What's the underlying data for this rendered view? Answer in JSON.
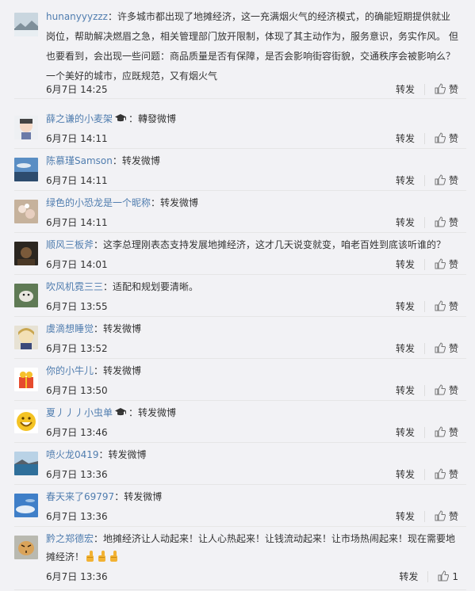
{
  "actions": {
    "repost_label": "转发",
    "like_label": "赞"
  },
  "comments": [
    {
      "user": "hunanyyyzzz",
      "text": "：许多城市都出现了地摊经济，这一充满烟火气的经济模式，的确能短期提供就业岗位，帮助解决燃眉之急，相关管理部门放开限制，体现了其主动作为，服务意识，务实作风。 但也要看到，会出现一些问题：商品质量是否有保障，是否会影响街容街貌，交通秩序会被影响么？ 一个美好的城市，应既规范，又有烟火气",
      "time": "6月7日 14:25",
      "avatar": "mountain"
    },
    {
      "user": "薛之谦的小麦架",
      "badge": true,
      "text": "：轉發微博",
      "time": "6月7日 14:11",
      "avatar": "cartoon"
    },
    {
      "user": "陈慕瑾Samson",
      "text": "：转发微博",
      "time": "6月7日 14:11",
      "avatar": "sky"
    },
    {
      "user": "绿色的小恐龙是一个昵称",
      "text": "：转发微博",
      "time": "6月7日 14:11",
      "avatar": "flower"
    },
    {
      "user": "顺风三板斧",
      "text": "：这李总理刚表态支持发展地摊经济，这才几天说变就变，咱老百姓到底该听谁的？",
      "time": "6月7日 14:01",
      "avatar": "night"
    },
    {
      "user": "吹风机霓三三",
      "text": "：适配和规划要清晰。",
      "time": "6月7日 13:55",
      "avatar": "animal"
    },
    {
      "user": "虞滴想睡觉",
      "text": "：转发微博",
      "time": "6月7日 13:52",
      "avatar": "anime"
    },
    {
      "user": "你的小牛儿",
      "text": "：转发微博",
      "time": "6月7日 13:50",
      "avatar": "gift"
    },
    {
      "user": "夏丿丿丿小虫单",
      "badge": true,
      "text": "：转发微博",
      "time": "6月7日 13:46",
      "avatar": "smile"
    },
    {
      "user": "喷火龙0419",
      "text": "：转发微博",
      "time": "6月7日 13:36",
      "avatar": "ocean"
    },
    {
      "user": "春天来了69797",
      "text": "：转发微博",
      "time": "6月7日 13:36",
      "avatar": "bluesky"
    },
    {
      "user": "黔之郑德宏",
      "text": "：地摊经济让人动起来！让人心热起来！让钱流动起来！让市场热闹起来！现在需要地摊经济！",
      "time": "6月7日 13:36",
      "avatar": "tiger",
      "likes": "1"
    }
  ],
  "colors": {
    "username": "#507daf",
    "text": "#333333",
    "bg": "#f2f2f5"
  }
}
